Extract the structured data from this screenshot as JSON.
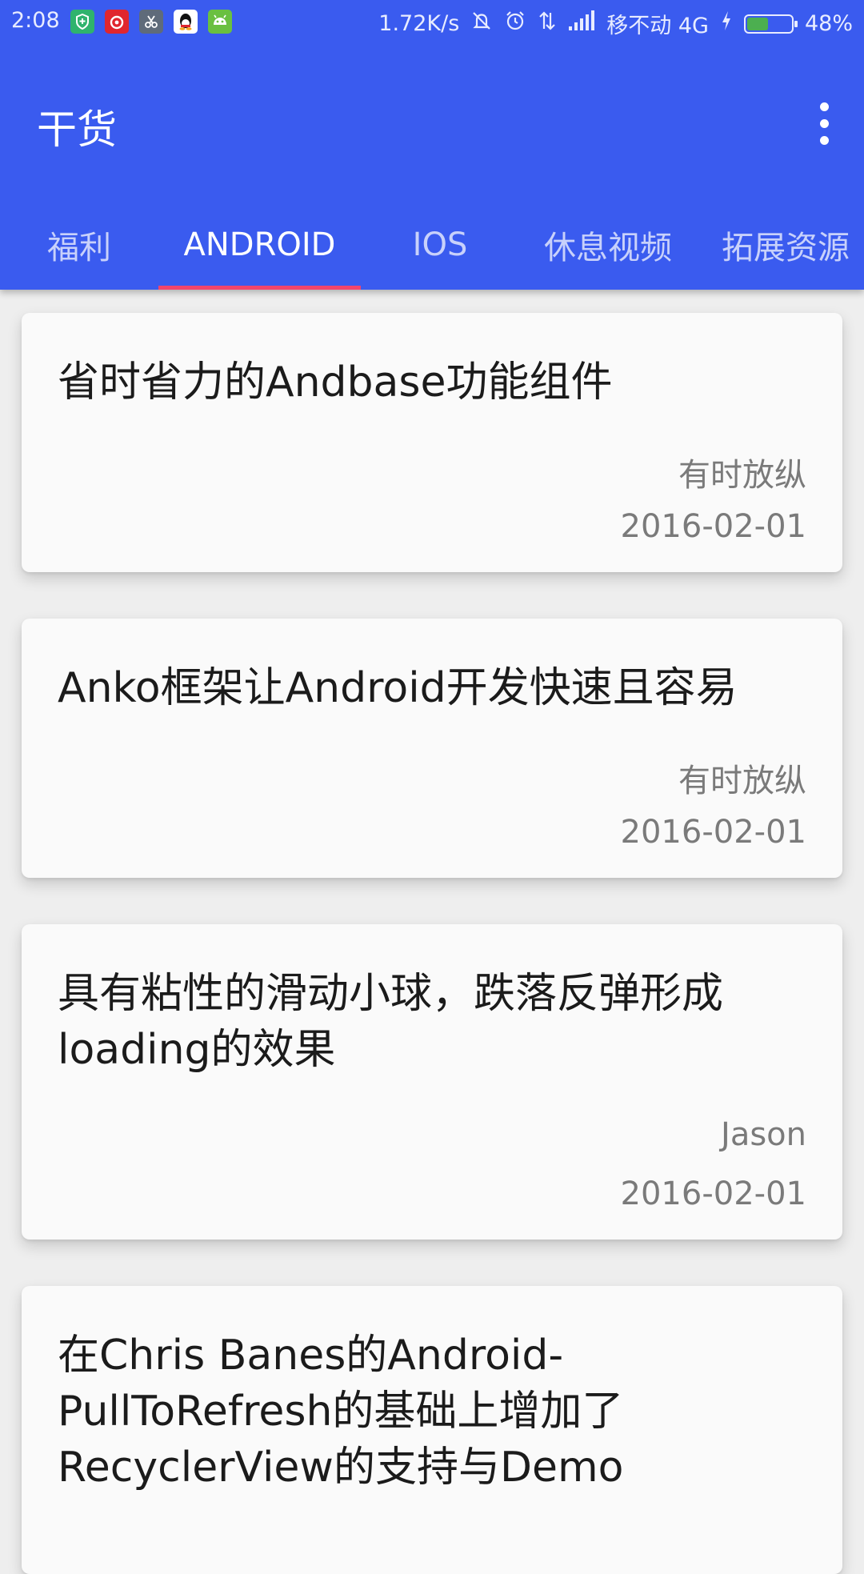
{
  "status_bar": {
    "time": "2:08",
    "net_speed": "1.72K/s",
    "carrier": "移不动 4G",
    "battery": "48%",
    "battery_level": 0.48,
    "app_icons": [
      "shield-app-icon",
      "netease-music-icon",
      "scissors-app-icon",
      "qq-icon",
      "android-app-icon"
    ],
    "status_icons": [
      "mute-icon",
      "alarm-icon",
      "data-transfer-icon",
      "signal-icon",
      "charging-icon",
      "battery-icon"
    ],
    "colors": {
      "shield": "#2fb36d",
      "music": "#e0262e",
      "scissors": "#5f6b7a",
      "qq": "#ffffff",
      "android": "#6ac040",
      "battery_fill": "#4caf50"
    }
  },
  "toolbar": {
    "title": "干货",
    "menu_icon": "more-vert-icon",
    "color": "#3a5bef"
  },
  "tabs": [
    {
      "label": "福利",
      "active": false
    },
    {
      "label": "ANDROID",
      "active": true
    },
    {
      "label": "IOS",
      "active": false
    },
    {
      "label": "休息视频",
      "active": false
    },
    {
      "label": "拓展资源",
      "active": false
    }
  ],
  "tab_indicator_color": "#f3456c",
  "articles": [
    {
      "title": "省时省力的Andbase功能组件",
      "author": "有时放纵",
      "date": "2016-02-01"
    },
    {
      "title": "Anko框架让Android开发快速且容易",
      "author": "有时放纵",
      "date": "2016-02-01"
    },
    {
      "title": "具有粘性的滑动小球，跌落反弹形成loading的效果",
      "author": "Jason",
      "date": "2016-02-01"
    },
    {
      "title": "在Chris Banes的Android-PullToRefresh的基础上增加了RecyclerView的支持与Demo",
      "author": "",
      "date": ""
    }
  ]
}
